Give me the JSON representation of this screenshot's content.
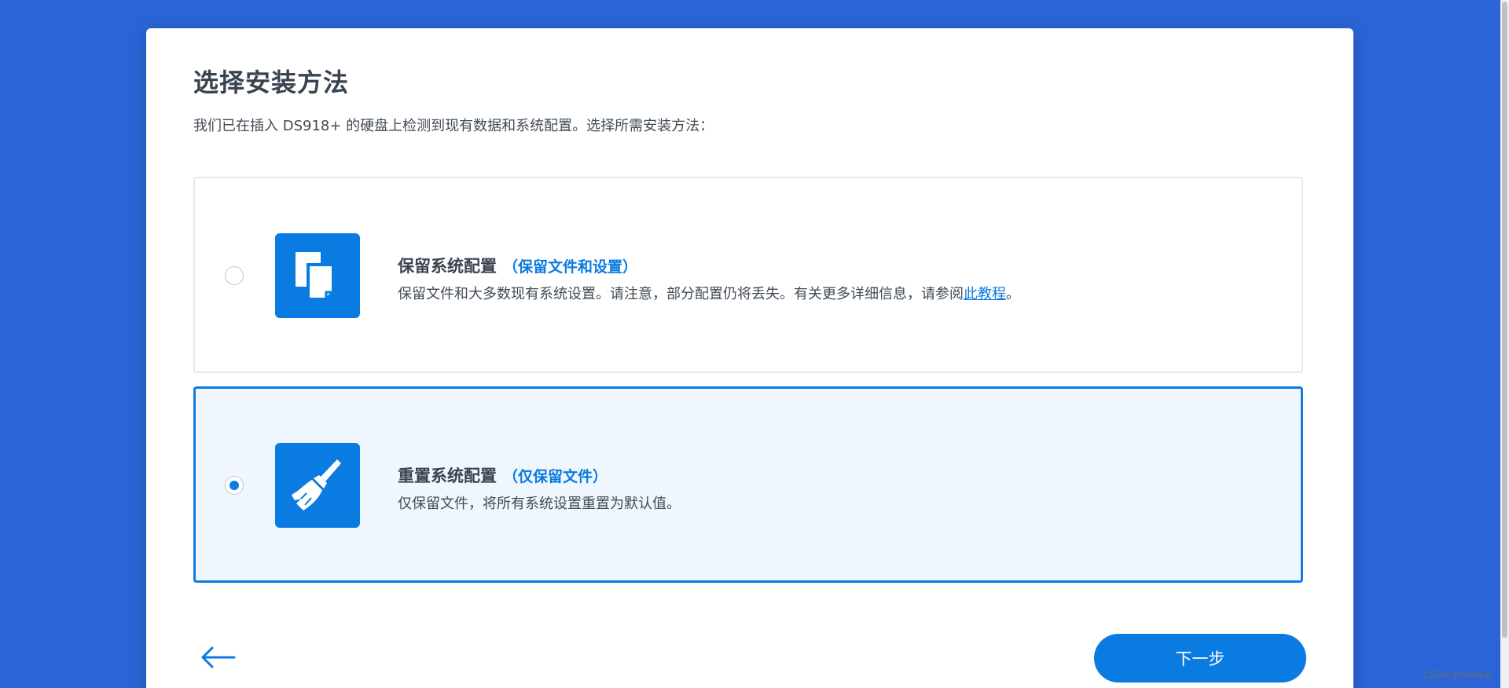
{
  "page": {
    "title": "选择安装方法",
    "subtitle": "我们已在插入 DS918+ 的硬盘上检测到现有数据和系统配置。选择所需安装方法："
  },
  "options": [
    {
      "heading": "保留系统配置",
      "tag": "（保留文件和设置）",
      "desc_before_link": "保留文件和大多数现有系统设置。请注意，部分配置仍将丢失。有关更多详细信息，请参阅",
      "link": "此教程",
      "desc_after_link": "。",
      "selected": false,
      "icon": "copy-files-icon"
    },
    {
      "heading": "重置系统配置",
      "tag": "（仅保留文件）",
      "desc": "仅保留文件，将所有系统设置重置为默认值。",
      "selected": true,
      "icon": "broom-icon"
    }
  ],
  "footer": {
    "back_icon": "arrow-left-icon",
    "next_label": "下一步"
  },
  "watermark": "CSDN @vistaup",
  "colors": {
    "background": "#2a64d6",
    "accent": "#0a7be0",
    "selected_bg": "#eff6fd"
  }
}
